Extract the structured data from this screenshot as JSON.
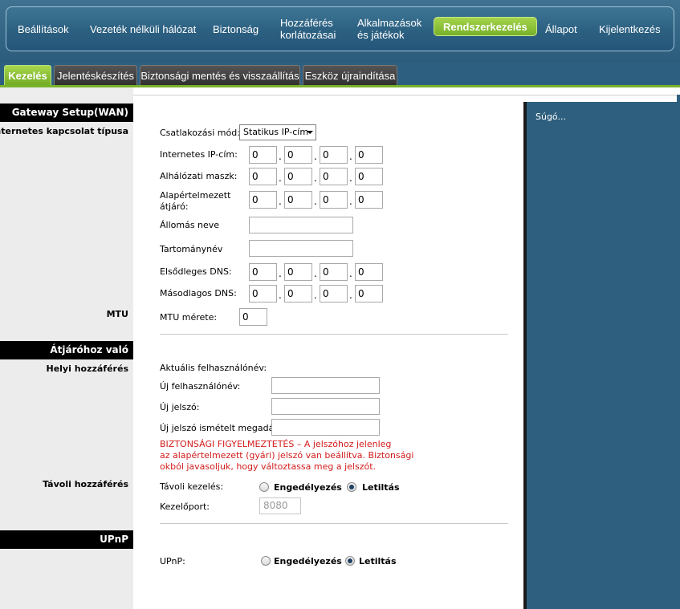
{
  "nav": {
    "items": [
      {
        "label": "Beállítások"
      },
      {
        "label": "Vezeték nélküli hálózat"
      },
      {
        "label": "Biztonság"
      },
      {
        "line1": "Hozzáférés",
        "line2": "korlátozásai"
      },
      {
        "line1": "Alkalmazások",
        "line2": "és játékok"
      },
      {
        "label": "Rendszerkezelés"
      },
      {
        "label": "Állapot"
      },
      {
        "label": "Kijelentkezés"
      }
    ]
  },
  "tabs": [
    {
      "label": "Kezelés"
    },
    {
      "label": "Jelentéskészítés"
    },
    {
      "label": "Biztonsági mentés és visszaállítás"
    },
    {
      "label": "Eszköz újraindítása"
    }
  ],
  "left": {
    "section_gateway": "Gateway Setup(WAN)",
    "internet_type": "Internetes kapcsolat típusa",
    "mtu": "MTU",
    "section_access": "Átjáróhoz való hozzáférés",
    "local_access": "Helyi hozzáférés",
    "remote_access": "Távoli hozzáférés",
    "section_upnp": "UPnP"
  },
  "help": {
    "link": "Súgó..."
  },
  "wan": {
    "connection_mode_label": "Csatlakozási mód:",
    "connection_mode_value": "Statikus IP-cím",
    "ip_label": "Internetes IP-cím:",
    "ip": [
      "0",
      "0",
      "0",
      "0"
    ],
    "mask_label": "Alhálózati maszk:",
    "mask": [
      "0",
      "0",
      "0",
      "0"
    ],
    "gateway_label_1": "Alapértelmezett",
    "gateway_label_2": "átjáró:",
    "gateway": [
      "0",
      "0",
      "0",
      "0"
    ],
    "host_label": "Állomás neve",
    "host_value": "",
    "domain_label": "Tartománynév",
    "domain_value": "",
    "dns1_label": "Elsődleges DNS:",
    "dns1": [
      "0",
      "0",
      "0",
      "0"
    ],
    "dns2_label": "Másodlagos DNS:",
    "dns2": [
      "0",
      "0",
      "0",
      "0"
    ],
    "mtu_label": "MTU mérete:",
    "mtu_value": "0"
  },
  "access": {
    "current_user_label": "Aktuális felhasználónév:",
    "new_user_label": "Új felhasználónév:",
    "new_user_value": "",
    "new_pass_label": "Új jelszó:",
    "new_pass_value": "",
    "confirm_pass_label": "Új jelszó ismételt megadása:",
    "confirm_pass_value": "",
    "warning_lines": [
      "BIZTONSÁGI FIGYELMEZTETÉS – A jelszóhoz jelenleg",
      "az alapértelmezett (gyári) jelszó van beállítva. Biztonsági",
      "okból javasoljuk, hogy változtassa meg a jelszót."
    ],
    "remote_mgmt_label": "Távoli kezelés:",
    "enable_label": "Engedélyezés",
    "disable_label": "Letiltás",
    "remote_selected": "disable",
    "port_label": "Kezelőport:",
    "port_value": "8080"
  },
  "upnp": {
    "label": "UPnP:",
    "enable_label": "Engedélyezés",
    "disable_label": "Letiltás",
    "selected": "disable"
  }
}
